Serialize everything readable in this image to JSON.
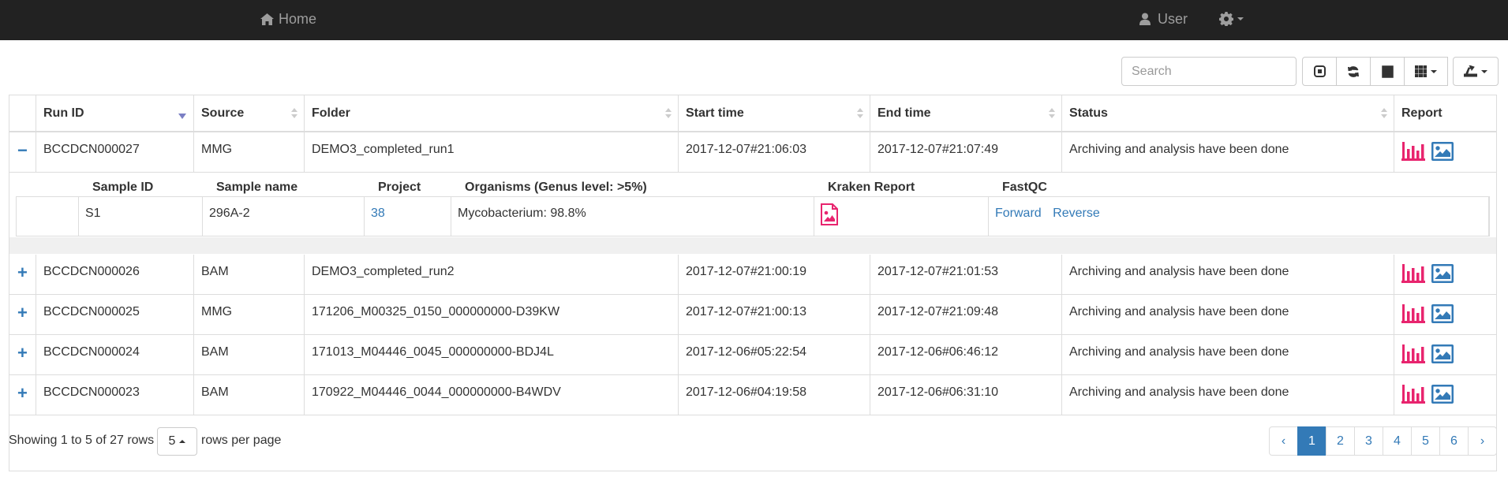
{
  "navbar": {
    "home_label": "Home",
    "user_label": "User"
  },
  "search": {
    "placeholder": "Search"
  },
  "toolbar": {
    "buttons": [
      "paginate",
      "refresh",
      "toggle-view",
      "columns",
      "export"
    ]
  },
  "table": {
    "columns": [
      "Run ID",
      "Source",
      "Folder",
      "Start time",
      "End time",
      "Status",
      "Report"
    ],
    "rows": [
      {
        "toggle": "−",
        "run_id": "BCCDCN000027",
        "source": "MMG",
        "folder": "DEMO3_completed_run1",
        "start": "2017-12-07#21:06:03",
        "end": "2017-12-07#21:07:49",
        "status": "Archiving and analysis have been done"
      },
      {
        "toggle": "+",
        "run_id": "BCCDCN000026",
        "source": "BAM",
        "folder": "DEMO3_completed_run2",
        "start": "2017-12-07#21:00:19",
        "end": "2017-12-07#21:01:53",
        "status": "Archiving and analysis have been done"
      },
      {
        "toggle": "+",
        "run_id": "BCCDCN000025",
        "source": "MMG",
        "folder": "171206_M00325_0150_000000000-D39KW",
        "start": "2017-12-07#21:00:13",
        "end": "2017-12-07#21:09:48",
        "status": "Archiving and analysis have been done"
      },
      {
        "toggle": "+",
        "run_id": "BCCDCN000024",
        "source": "BAM",
        "folder": "171013_M04446_0045_000000000-BDJ4L",
        "start": "2017-12-06#05:22:54",
        "end": "2017-12-06#06:46:12",
        "status": "Archiving and analysis have been done"
      },
      {
        "toggle": "+",
        "run_id": "BCCDCN000023",
        "source": "BAM",
        "folder": "170922_M04446_0044_000000000-B4WDV",
        "start": "2017-12-06#04:19:58",
        "end": "2017-12-06#06:31:10",
        "status": "Archiving and analysis have been done"
      }
    ]
  },
  "detail": {
    "columns": [
      "Sample ID",
      "Sample name",
      "Project",
      "Organisms (Genus level: >5%)",
      "Kraken Report",
      "FastQC"
    ],
    "row": {
      "sample_id": "S1",
      "sample_name": "296A-2",
      "project": "38",
      "organisms": "Mycobacterium: 98.8%",
      "fastqc_forward": "Forward",
      "fastqc_reverse": "Reverse"
    }
  },
  "footer": {
    "showing": "Showing 1 to 5 of 27 rows",
    "page_size": "5",
    "rows_per_page": "rows per page"
  },
  "pagination": {
    "prev": "‹",
    "pages": [
      "1",
      "2",
      "3",
      "4",
      "5",
      "6"
    ],
    "next": "›",
    "active": "1"
  },
  "colors": {
    "accent": "#337ab7",
    "report_icon": "#e8246e",
    "image_icon": "#337ab7",
    "navbar": "#222222"
  }
}
